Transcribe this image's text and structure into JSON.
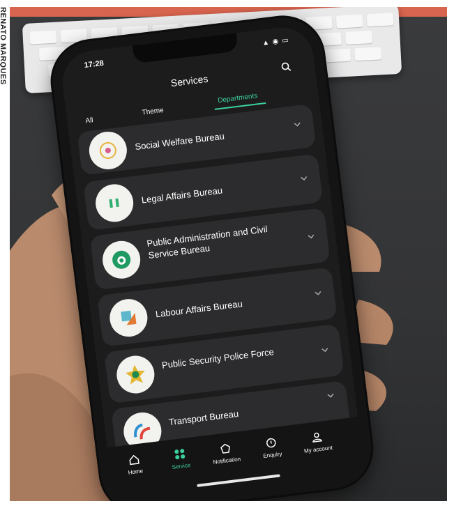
{
  "photo_credit": "RENATO MARQUES",
  "status_bar": {
    "time": "17:28",
    "icons": "▲ ◉ ▭"
  },
  "header": {
    "title": "Services",
    "search_icon": "search-icon"
  },
  "tabs": [
    {
      "label": "All",
      "active": false
    },
    {
      "label": "Theme",
      "active": false
    },
    {
      "label": "Departments",
      "active": true
    }
  ],
  "departments": [
    {
      "label": "Social Welfare Bureau",
      "logo": "social-welfare-logo"
    },
    {
      "label": "Legal Affairs Bureau",
      "logo": "legal-affairs-logo"
    },
    {
      "label": "Public Administration and Civil Service Bureau",
      "logo": "safp-logo"
    },
    {
      "label": "Labour Affairs Bureau",
      "logo": "labour-affairs-logo"
    },
    {
      "label": "Public Security Police Force",
      "logo": "police-logo"
    },
    {
      "label": "Transport Bureau",
      "logo": "transport-logo"
    }
  ],
  "tab_bar": [
    {
      "label": "Home",
      "icon": "home-icon",
      "active": false
    },
    {
      "label": "Service",
      "icon": "service-icon",
      "active": true
    },
    {
      "label": "Notification",
      "icon": "notification-icon",
      "active": false
    },
    {
      "label": "Enquiry",
      "icon": "enquiry-icon",
      "active": false
    },
    {
      "label": "My account",
      "icon": "account-icon",
      "active": false
    }
  ],
  "colors": {
    "accent": "#3ccf9e",
    "card": "#2c2c2e",
    "screen": "#1c1c1d",
    "banner": "#d8654f"
  }
}
